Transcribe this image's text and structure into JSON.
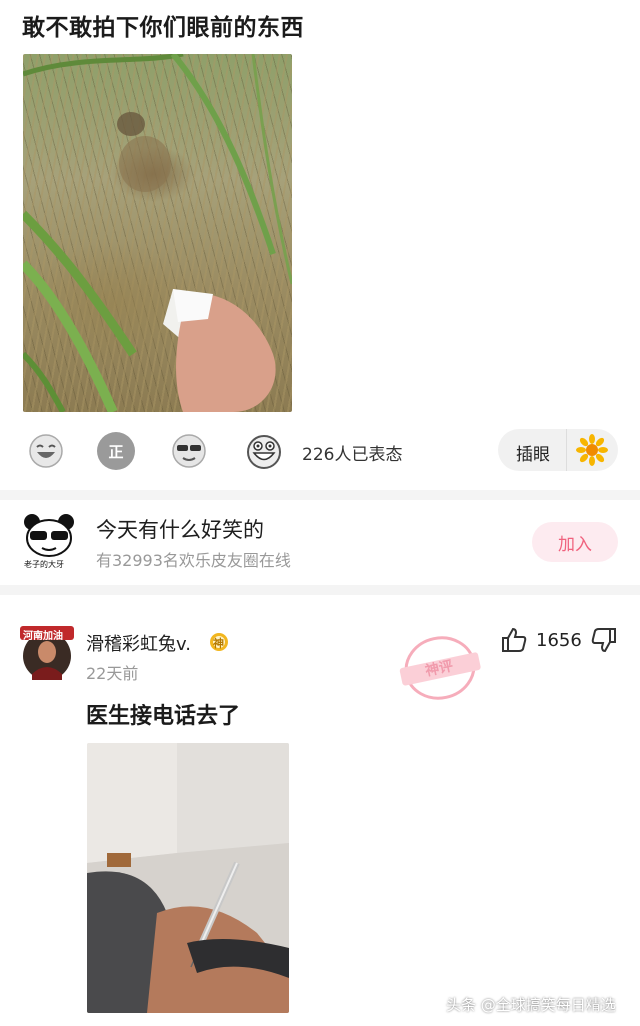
{
  "post": {
    "title": "敢不敢拍下你们眼前的东西"
  },
  "reactions": {
    "icons": [
      "laugh-icon",
      "zheng-icon",
      "cool-sunglasses-icon",
      "grin-icon"
    ],
    "zheng_label": "正",
    "count_text": "226人已表态"
  },
  "insert_button": {
    "label": "插眼"
  },
  "group": {
    "avatar_caption": "老子的大牙",
    "name": "今天有什么好笑的",
    "online_text": "有32993名欢乐皮友圈在线",
    "join_label": "加入"
  },
  "comment": {
    "avatar_caption": "河南加油",
    "username": "滑稽彩虹兔v.",
    "badge": "神",
    "time": "22天前",
    "like_count": "1656",
    "text": "医生接电话去了",
    "stamp_text": "神评"
  },
  "watermark": {
    "text": "头条 @全球搞笑每日精选"
  },
  "colors": {
    "accent_pink": "#f0627e",
    "join_bg": "#fdebf0",
    "muted_text": "#999999"
  }
}
